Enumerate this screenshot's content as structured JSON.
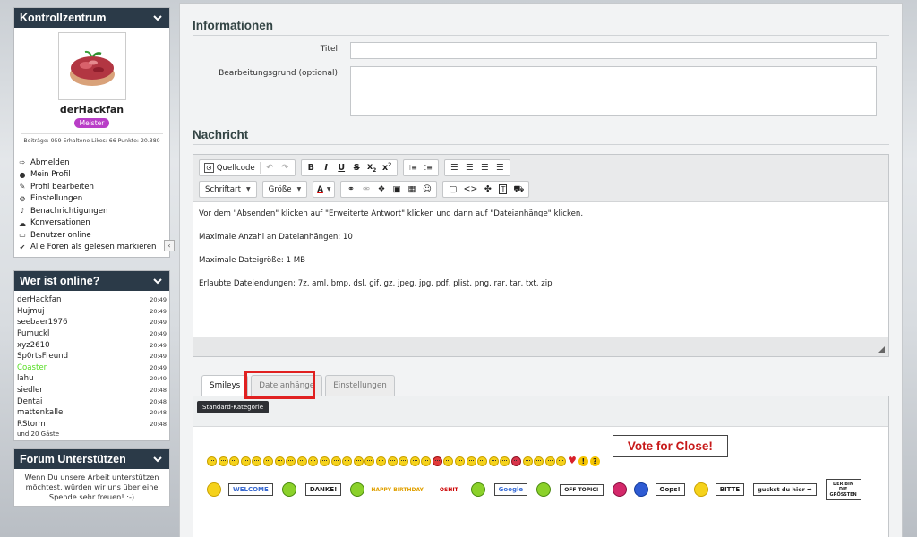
{
  "sidebar": {
    "control": {
      "title": "Kontrollzentrum",
      "username": "derHackfan",
      "rank": "Meister",
      "stats": "Beiträge: 959   Erhaltene Likes: 66   Punkte: 20.380",
      "menu": [
        {
          "label": "Abmelden",
          "icon": "logout-icon"
        },
        {
          "label": "Mein Profil",
          "icon": "user-icon"
        },
        {
          "label": "Profil bearbeiten",
          "icon": "wrench-icon"
        },
        {
          "label": "Einstellungen",
          "icon": "gears-icon"
        },
        {
          "label": "Benachrichtigungen",
          "icon": "bell-icon"
        },
        {
          "label": "Konversationen",
          "icon": "chat-icon"
        },
        {
          "label": "Benutzer online",
          "icon": "monitor-icon"
        },
        {
          "label": "Alle Foren als gelesen markieren",
          "icon": "check-icon"
        }
      ],
      "collapse_glyph": "‹"
    },
    "online": {
      "title": "Wer ist online?",
      "users": [
        {
          "name": "derHackfan",
          "time": "20:49",
          "color": "#222222"
        },
        {
          "name": "Hujmuj",
          "time": "20:49",
          "color": "#222222"
        },
        {
          "name": "seebaer1976",
          "time": "20:49",
          "color": "#222222"
        },
        {
          "name": "Pumuckl",
          "time": "20:49",
          "color": "#222222"
        },
        {
          "name": "xyz2610",
          "time": "20:49",
          "color": "#222222"
        },
        {
          "name": "Sp0rtsFreund",
          "time": "20:49",
          "color": "#222222"
        },
        {
          "name": "Coaster",
          "time": "20:49",
          "color": "#55dd22"
        },
        {
          "name": "lahu",
          "time": "20:49",
          "color": "#222222"
        },
        {
          "name": "siedler",
          "time": "20:48",
          "color": "#222222"
        },
        {
          "name": "Dentai",
          "time": "20:48",
          "color": "#222222"
        },
        {
          "name": "mattenkalle",
          "time": "20:48",
          "color": "#222222"
        },
        {
          "name": "RStorm",
          "time": "20:48",
          "color": "#222222"
        }
      ],
      "guests": "und 20 Gäste"
    },
    "support": {
      "title": "Forum Unterstützen",
      "text": "Wenn Du unsere Arbeit unterstützen möchtest, würden wir uns über eine Spende sehr freuen! :-)"
    }
  },
  "main": {
    "info_title": "Informationen",
    "title_label": "Titel",
    "title_value": "",
    "reason_label": "Bearbeitungsgrund (optional)",
    "reason_value": "",
    "message_title": "Nachricht",
    "toolbar": {
      "source": "Quellcode",
      "font": "Schriftart",
      "size": "Größe",
      "color_glyph": "A"
    },
    "body": [
      "Vor dem \"Absenden\" klicken auf \"Erweiterte Antwort\" klicken und dann auf \"Dateianhänge\" klicken.",
      "Maximale Anzahl an Dateianhängen: 10",
      "Maximale Dateigröße: 1 MB",
      "Erlaubte Dateiendungen: 7z, aml, bmp, dsl, gif, gz, jpeg, jpg, pdf, plist, png, rar, tar, txt, zip"
    ],
    "tabs": [
      "Smileys",
      "Dateianhänge",
      "Einstellungen"
    ],
    "category": "Standard-Kategorie",
    "vote": "Vote for Close!",
    "signs": [
      "WELCOME",
      "DANKE!",
      "HAPPY BIRTHDAY",
      "OSHIT",
      "Google",
      "OFF TOPIC!",
      "Oops!",
      "BITTE",
      "guckst du hier ➡",
      "DER BIN DIE GRÖSSTEN"
    ]
  },
  "colors": {
    "header": "#2b3a48",
    "rank_badge": "#b93ec7",
    "highlight": "#e02020",
    "vote_text": "#c71a1a"
  }
}
